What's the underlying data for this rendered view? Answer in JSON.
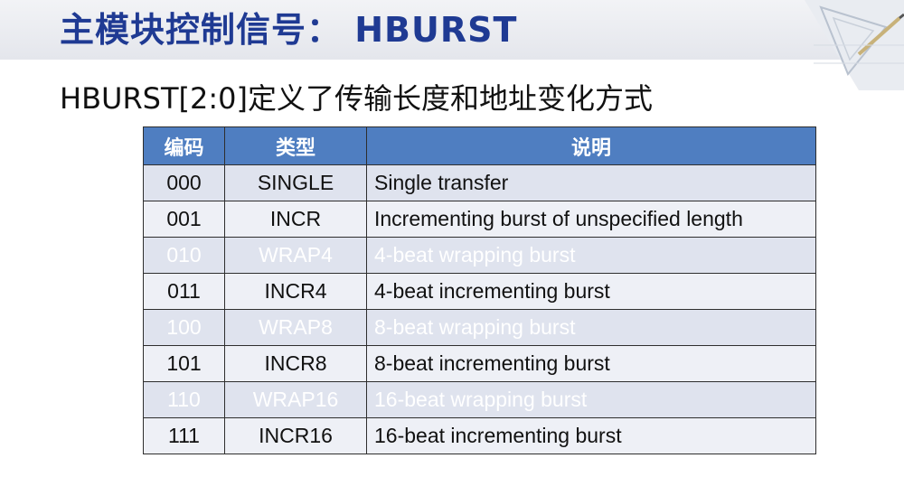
{
  "slide": {
    "title": "主模块控制信号： HBURST",
    "subtitle": "HBURST[2:0]定义了传输长度和地址变化方式"
  },
  "table": {
    "headers": [
      "编码",
      "类型",
      "说明"
    ],
    "rows": [
      {
        "code": "000",
        "type": "SINGLE",
        "desc": "Single transfer"
      },
      {
        "code": "001",
        "type": "INCR",
        "desc": "Incrementing burst of unspecified length"
      },
      {
        "code": "010",
        "type": "WRAP4",
        "desc": "4-beat wrapping burst"
      },
      {
        "code": "011",
        "type": "INCR4",
        "desc": "4-beat incrementing burst"
      },
      {
        "code": "100",
        "type": "WRAP8",
        "desc": "8-beat wrapping burst"
      },
      {
        "code": "101",
        "type": "INCR8",
        "desc": "8-beat incrementing burst"
      },
      {
        "code": "110",
        "type": "WRAP16",
        "desc": "16-beat wrapping burst"
      },
      {
        "code": "111",
        "type": "INCR16",
        "desc": "16-beat incrementing burst"
      }
    ]
  },
  "colors": {
    "title": "#1f3a93",
    "header_bg": "#4f7ec1",
    "row_bg": "#dfe3ee",
    "row_alt_bg": "#eef0f6"
  }
}
